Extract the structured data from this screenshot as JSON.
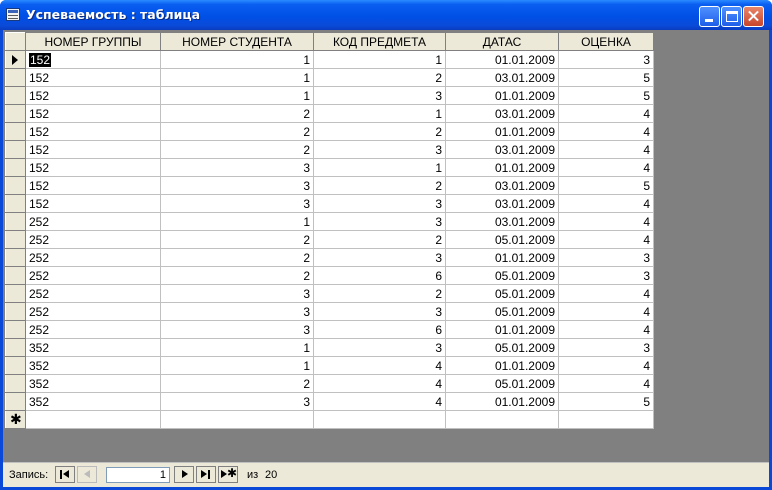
{
  "window": {
    "title": "Успеваемость : таблица",
    "icon": "table-icon"
  },
  "table": {
    "columns": [
      "НОМЕР ГРУППЫ",
      "НОМЕР СТУДЕНТА",
      "КОД ПРЕДМЕТА",
      "ДАТАС",
      "ОЦЕНКА"
    ],
    "rows": [
      [
        "152",
        "1",
        "1",
        "01.01.2009",
        "3"
      ],
      [
        "152",
        "1",
        "2",
        "03.01.2009",
        "5"
      ],
      [
        "152",
        "1",
        "3",
        "01.01.2009",
        "5"
      ],
      [
        "152",
        "2",
        "1",
        "03.01.2009",
        "4"
      ],
      [
        "152",
        "2",
        "2",
        "01.01.2009",
        "4"
      ],
      [
        "152",
        "2",
        "3",
        "03.01.2009",
        "4"
      ],
      [
        "152",
        "3",
        "1",
        "01.01.2009",
        "4"
      ],
      [
        "152",
        "3",
        "2",
        "03.01.2009",
        "5"
      ],
      [
        "152",
        "3",
        "3",
        "03.01.2009",
        "4"
      ],
      [
        "252",
        "1",
        "3",
        "03.01.2009",
        "4"
      ],
      [
        "252",
        "2",
        "2",
        "05.01.2009",
        "4"
      ],
      [
        "252",
        "2",
        "3",
        "01.01.2009",
        "3"
      ],
      [
        "252",
        "2",
        "6",
        "05.01.2009",
        "3"
      ],
      [
        "252",
        "3",
        "2",
        "05.01.2009",
        "4"
      ],
      [
        "252",
        "3",
        "3",
        "05.01.2009",
        "4"
      ],
      [
        "252",
        "3",
        "6",
        "01.01.2009",
        "4"
      ],
      [
        "352",
        "1",
        "3",
        "05.01.2009",
        "3"
      ],
      [
        "352",
        "1",
        "4",
        "01.01.2009",
        "4"
      ],
      [
        "352",
        "2",
        "4",
        "05.01.2009",
        "4"
      ],
      [
        "352",
        "3",
        "4",
        "01.01.2009",
        "5"
      ]
    ],
    "current_row_icon": "current-record-arrow-icon",
    "new_row_icon": "new-record-star-icon"
  },
  "navigation": {
    "label": "Запись:",
    "current_record": "1",
    "of_label": "из",
    "total_records": "20",
    "buttons": [
      "first-record-icon",
      "previous-record-icon",
      "next-record-icon",
      "last-record-icon",
      "new-record-icon"
    ]
  },
  "colors": {
    "titlebar": "#0050e6",
    "workspace": "#808080",
    "header_bg": "#ece9d8",
    "close_button": "#c8462a"
  }
}
